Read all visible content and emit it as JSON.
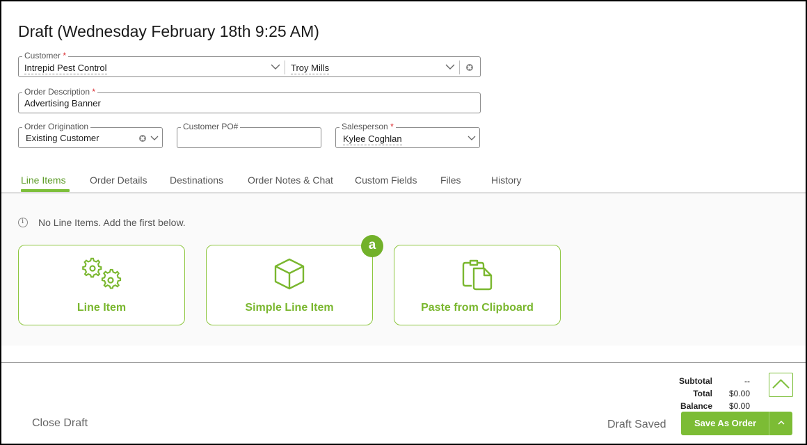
{
  "title": "Draft (Wednesday February 18th 9:25 AM)",
  "form": {
    "customer": {
      "label": "Customer",
      "required": "*",
      "value": "Intrepid Pest Control",
      "contact": "Troy Mills"
    },
    "description": {
      "label": "Order Description",
      "required": "*",
      "value": "Advertising Banner"
    },
    "origination": {
      "label": "Order Origination",
      "value": "Existing Customer"
    },
    "po": {
      "label": "Customer PO#",
      "value": ""
    },
    "salesperson": {
      "label": "Salesperson",
      "required": "*",
      "value": "Kylee Coghlan"
    }
  },
  "tabs": [
    {
      "label": "Line Items",
      "active": true
    },
    {
      "label": "Order Details"
    },
    {
      "label": "Destinations"
    },
    {
      "label": "Order Notes & Chat"
    },
    {
      "label": "Custom Fields"
    },
    {
      "label": "Files"
    },
    {
      "label": "History"
    }
  ],
  "line_items": {
    "empty_message": "No Line Items. Add the first below.",
    "cards": [
      {
        "label": "Line Item",
        "icon": "gears-icon"
      },
      {
        "label": "Simple Line Item",
        "icon": "cube-icon"
      },
      {
        "label": "Paste from Clipboard",
        "icon": "clipboard-icon"
      }
    ],
    "badge": "a"
  },
  "totals": {
    "subtotal_label": "Subtotal",
    "subtotal": "--",
    "total_label": "Total",
    "total": "$0.00",
    "balance_label": "Balance",
    "balance": "$0.00"
  },
  "footer": {
    "close_label": "Close Draft",
    "status": "Draft Saved",
    "save_label": "Save As Order"
  },
  "colors": {
    "accent": "#7cbc35",
    "required": "#d9262b",
    "border": "#8a8a8a"
  }
}
